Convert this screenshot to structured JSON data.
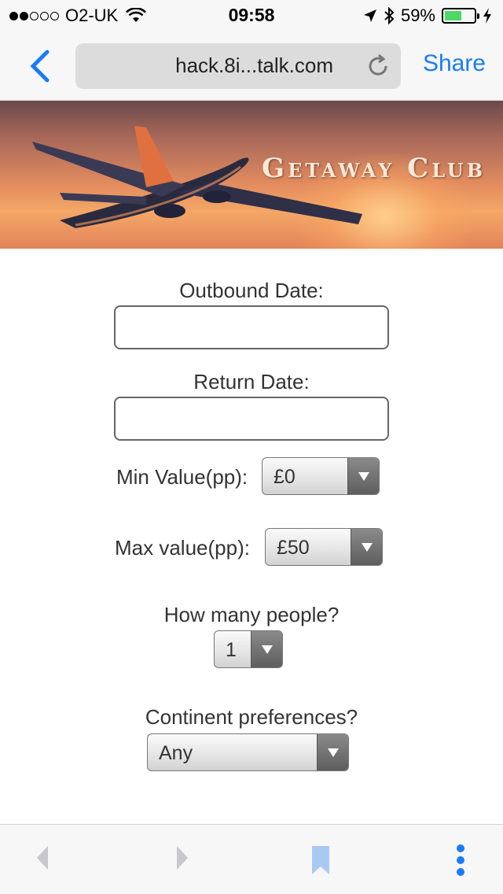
{
  "status_bar": {
    "carrier": "O2-UK",
    "time": "09:58",
    "battery_percent": "59%",
    "battery_level": 0.59,
    "battery_color": "#4cd964"
  },
  "nav_bar": {
    "url": "hack.8i...talk.com",
    "share_label": "Share",
    "accent_color": "#1a7cf5",
    "icons": [
      "back-chevron-icon",
      "reload-icon"
    ]
  },
  "banner": {
    "title": "Getaway Club",
    "image": "airplane-at-sunset"
  },
  "form": {
    "outbound_label": "Outbound Date:",
    "outbound_value": "",
    "return_label": "Return Date:",
    "return_value": "",
    "min_value_label": "Min Value(pp):",
    "min_value_selected": "£0",
    "max_value_label": "Max value(pp):",
    "max_value_selected": "£50",
    "people_label": "How many people?",
    "people_selected": "1",
    "continent_label": "Continent preferences?",
    "continent_selected": "Any"
  },
  "toolbar": {
    "icons": [
      "back-arrow-icon",
      "forward-arrow-icon",
      "bookmark-icon",
      "more-options-icon"
    ]
  }
}
